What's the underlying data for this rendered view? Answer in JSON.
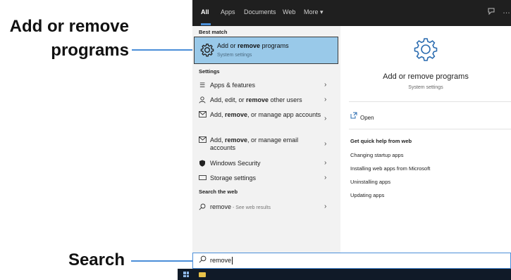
{
  "callouts": {
    "add_remove_line1": "Add or remove",
    "add_remove_line2": "programs",
    "search": "Search"
  },
  "tabs": [
    "All",
    "Apps",
    "Documents",
    "Web",
    "More ▾"
  ],
  "top_icons": {
    "feedback": "feedback-icon",
    "more": "…"
  },
  "best_match": {
    "section_label": "Best match",
    "title_pre": "Add or ",
    "title_bold": "remove",
    "title_post": " programs",
    "subtitle": "System settings",
    "icon": "gear-icon"
  },
  "settings": {
    "section_label": "Settings",
    "items": [
      {
        "icon": "apps-list-icon",
        "pre": "Apps & features",
        "bold": "",
        "post": ""
      },
      {
        "icon": "person-icon",
        "pre": "Add, edit, or ",
        "bold": "remove",
        "post": " other users"
      },
      {
        "icon": "mail-icon",
        "pre": "Add, ",
        "bold": "remove",
        "post": ", or manage app accounts"
      },
      {
        "icon": "mail-icon",
        "pre": "Add, ",
        "bold": "remove",
        "post": ", or manage email accounts"
      },
      {
        "icon": "shield-icon",
        "pre": "Windows Security",
        "bold": "",
        "post": ""
      },
      {
        "icon": "storage-icon",
        "pre": "Storage settings",
        "bold": "",
        "post": ""
      }
    ]
  },
  "web": {
    "section_label": "Search the web",
    "query": "remove",
    "suffix": " - See web results"
  },
  "detail": {
    "title": "Add or remove programs",
    "subtitle": "System settings",
    "open_label": "Open",
    "help_heading": "Get quick help from web",
    "links": [
      "Changing startup apps",
      "Installing web apps from Microsoft",
      "Uninstalling apps",
      "Updating apps"
    ]
  },
  "search": {
    "value": "remove"
  },
  "colors": {
    "accent": "#4a8ed8",
    "highlight": "#99c9e9",
    "topbar": "#1f1f1f",
    "taskbar": "#101a28"
  }
}
